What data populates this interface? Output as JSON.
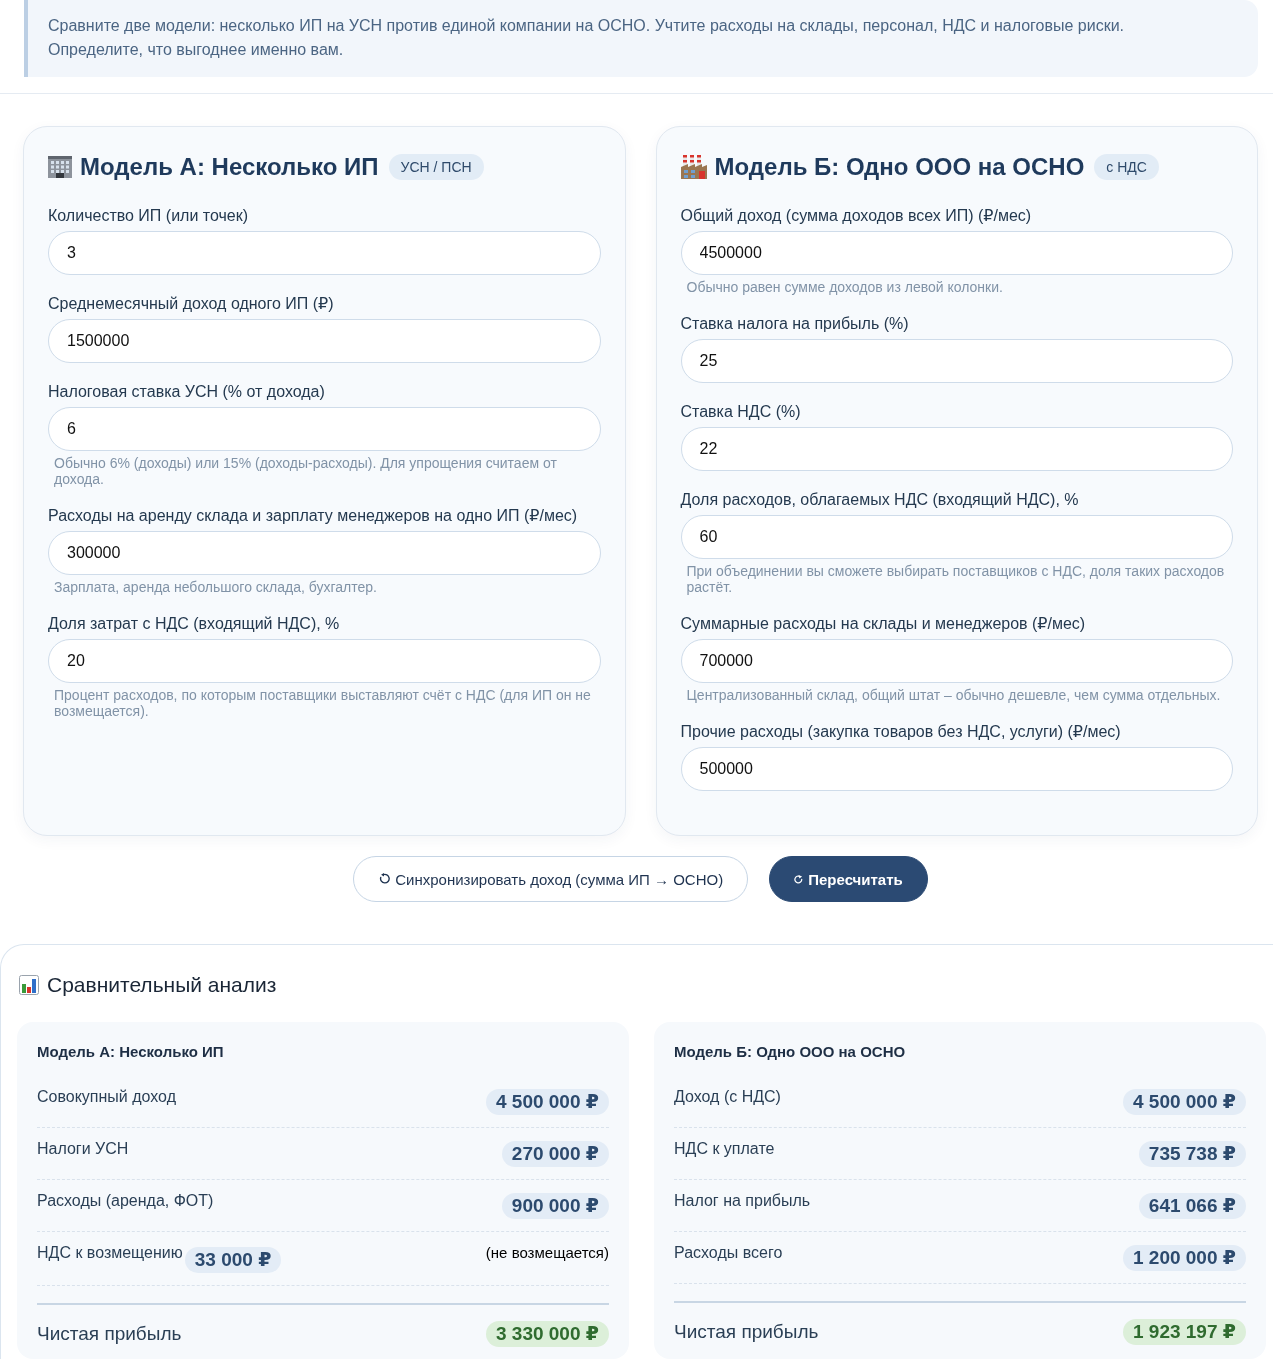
{
  "intro": {
    "text": "Сравните две модели: несколько ИП на УСН против единой компании на ОСНО. Учтите расходы на склады, персонал, НДС и налоговые риски. Определите, что выгоднее именно вам."
  },
  "models": [
    {
      "kind": "store",
      "title": "Модель А: Несколько ИП",
      "badge": "УСН / ПСН",
      "fields": [
        {
          "label": "Количество ИП (или точек)",
          "value": "3"
        },
        {
          "label": "Среднемесячный доход одного ИП (₽)",
          "value": "1500000"
        },
        {
          "label": "Налоговая ставка УСН (% от дохода)",
          "value": "6",
          "hint": "Обычно 6% (доходы) или 15% (доходы-расходы). Для упрощения считаем от дохода."
        },
        {
          "label": "Расходы на аренду склада и зарплату менеджеров на одно ИП (₽/мес)",
          "value": "300000",
          "hint": "Зарплата, аренда небольшого склада, бухгалтер."
        },
        {
          "label": "Доля затрат с НДС (входящий НДС), %",
          "value": "20",
          "hint": "Процент расходов, по которым поставщики выставляют счёт с НДС (для ИП он не возмещается)."
        }
      ]
    },
    {
      "kind": "factory",
      "title": "Модель Б: Одно ООО на ОСНО",
      "badge": "с НДС",
      "fields": [
        {
          "label": "Общий доход (сумма доходов всех ИП) (₽/мес)",
          "value": "4500000",
          "hint": "Обычно равен сумме доходов из левой колонки."
        },
        {
          "label": "Ставка налога на прибыль (%)",
          "value": "25"
        },
        {
          "label": "Ставка НДС (%)",
          "value": "22"
        },
        {
          "label": "Доля расходов, облагаемых НДС (входящий НДС), %",
          "value": "60",
          "hint": "При объединении вы сможете выбирать поставщиков с НДС, доля таких расходов растёт."
        },
        {
          "label": "Суммарные расходы на склады и менеджеров (₽/мес)",
          "value": "700000",
          "hint": "Централизованный склад, общий штат – обычно дешевле, чем сумма отдельных."
        },
        {
          "label": "Прочие расходы (закупка товаров без НДС, услуги) (₽/мес)",
          "value": "500000"
        }
      ]
    }
  ],
  "actions": [
    {
      "kind": "secondary",
      "label": "Синхронизировать доход (сумма ИП → ОСНО)"
    },
    {
      "kind": "primary",
      "label": "Пересчитать"
    }
  ],
  "analysis": {
    "title": "Сравнительный анализ",
    "cards": [
      {
        "title": "Модель А: Несколько ИП",
        "rows": [
          {
            "label": "Совокупный доход",
            "value": "4 500 000 ₽"
          },
          {
            "label": "Налоги УСН",
            "value": "270 000 ₽"
          },
          {
            "label": "Расходы (аренда, ФОТ)",
            "value": "900 000 ₽"
          },
          {
            "label": "НДС к возмещению",
            "value": "33 000 ₽",
            "note": "(не возмещается)"
          }
        ],
        "total": {
          "label": "Чистая прибыль",
          "value": "3 330 000 ₽"
        }
      },
      {
        "title": "Модель Б: Одно ООО на ОСНО",
        "rows": [
          {
            "label": "Доход (с НДС)",
            "value": "4 500 000 ₽"
          },
          {
            "label": "НДС к уплате",
            "value": "735 738 ₽"
          },
          {
            "label": "Налог на прибыль",
            "value": "641 066 ₽"
          },
          {
            "label": "Расходы всего",
            "value": "1 200 000 ₽"
          }
        ],
        "total": {
          "label": "Чистая прибыль",
          "value": "1 923 197 ₽"
        }
      }
    ]
  }
}
